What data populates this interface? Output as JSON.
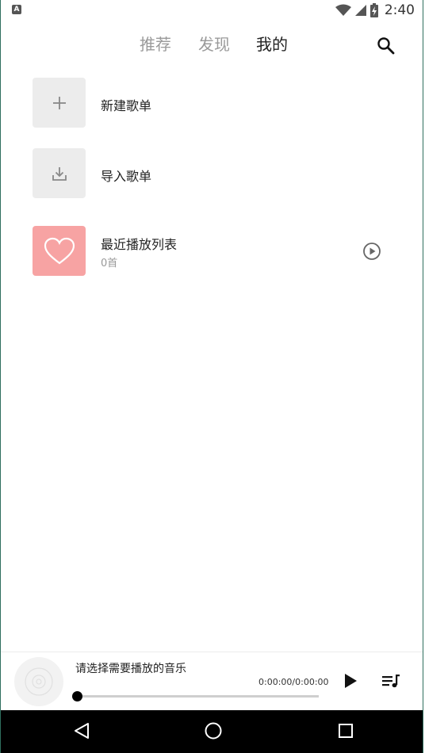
{
  "status_bar": {
    "notification_icon": "a-icon",
    "notification_letter": "A",
    "time": "2:40",
    "icons": [
      "wifi-icon",
      "signal-icon",
      "battery-charging-icon"
    ]
  },
  "header": {
    "tabs": [
      {
        "label": "推荐",
        "active": false
      },
      {
        "label": "发现",
        "active": false
      },
      {
        "label": "我的",
        "active": true
      }
    ],
    "search_icon": "search-icon"
  },
  "list": {
    "items": [
      {
        "title": "新建歌单",
        "icon": "plus-icon"
      },
      {
        "title": "导入歌单",
        "icon": "download-icon"
      },
      {
        "title": "最近播放列表",
        "subtitle": "0首",
        "icon": "heart-icon",
        "action_icon": "play-circle-icon"
      }
    ]
  },
  "player": {
    "title": "请选择需要播放的音乐",
    "time": "0:00:00/0:00:00",
    "progress": 0,
    "disc_icon": "disc-icon",
    "play_icon": "play-icon",
    "queue_icon": "playlist-icon"
  },
  "nav_bar": {
    "icons": [
      "back-icon",
      "home-icon",
      "recent-apps-icon"
    ]
  },
  "colors": {
    "accent_pink": "#f7a3a3",
    "thumb_gray": "#ececec",
    "tab_inactive": "#9a9a9a",
    "tab_active": "#222222"
  }
}
